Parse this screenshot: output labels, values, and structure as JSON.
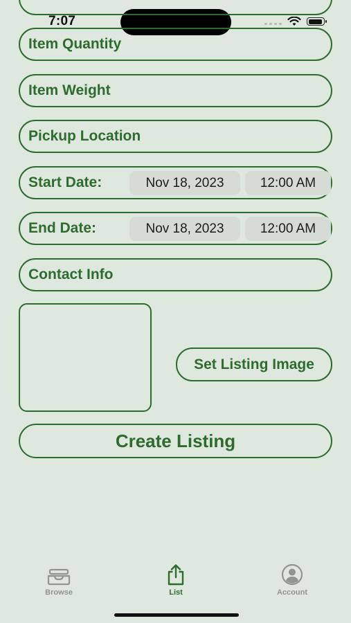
{
  "status_bar": {
    "time": "7:07"
  },
  "form": {
    "item_quantity_placeholder": "Item Quantity",
    "item_weight_placeholder": "Item Weight",
    "pickup_location_placeholder": "Pickup Location",
    "start_date": {
      "label": "Start Date:",
      "date": "Nov 18, 2023",
      "time": "12:00 AM"
    },
    "end_date": {
      "label": "End Date:",
      "date": "Nov 18, 2023",
      "time": "12:00 AM"
    },
    "contact_info_placeholder": "Contact Info",
    "set_image_label": "Set Listing Image",
    "create_label": "Create Listing"
  },
  "tab_bar": {
    "tabs": [
      {
        "label": "Browse",
        "icon": "tray-icon",
        "active": false
      },
      {
        "label": "List",
        "icon": "share-icon",
        "active": true
      },
      {
        "label": "Account",
        "icon": "person-circle-icon",
        "active": false
      }
    ]
  },
  "colors": {
    "accent": "#2e6b2e",
    "background": "#dfe8de",
    "inactive": "#8e968d"
  }
}
